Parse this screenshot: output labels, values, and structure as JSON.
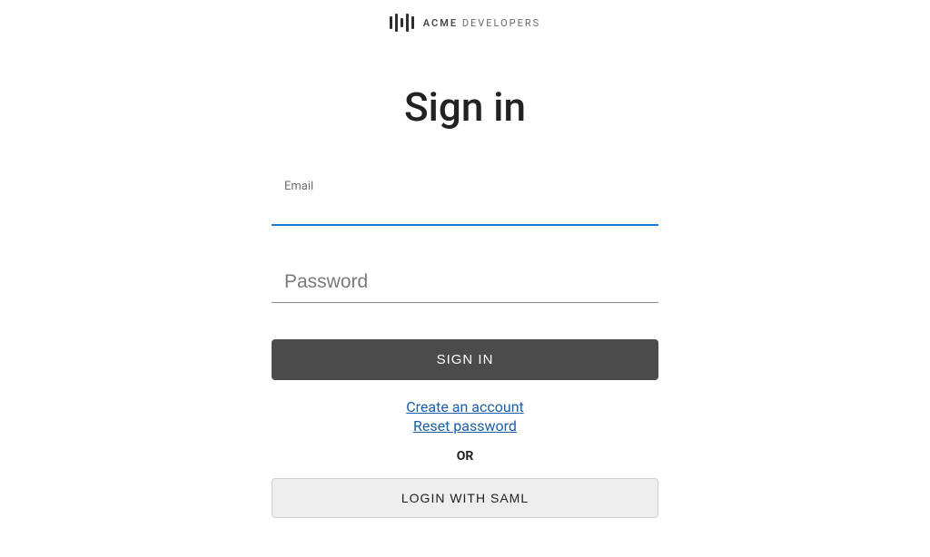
{
  "brand": {
    "name_strong": "ACME",
    "name_light": "DEVELOPERS"
  },
  "signin": {
    "heading": "Sign in",
    "email_label": "Email",
    "email_value": "",
    "password_placeholder": "Password",
    "password_value": "",
    "submit_label": "SIGN IN",
    "create_account_label": "Create an account",
    "reset_password_label": "Reset password",
    "divider_label": "OR",
    "saml_label": "LOGIN WITH SAML"
  }
}
